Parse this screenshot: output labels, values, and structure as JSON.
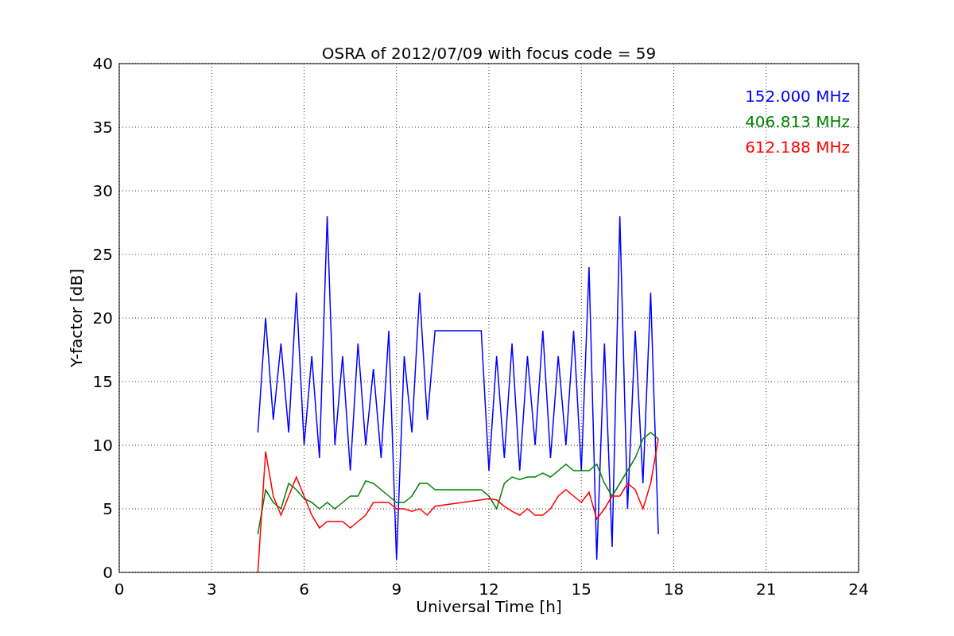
{
  "chart_data": {
    "type": "line",
    "grid": true,
    "title": "OSRA of 2012/07/09 with focus code = 59",
    "xlabel": "Universal Time [h]",
    "ylabel": "Y-factor [dB]",
    "xlim": [
      0,
      24
    ],
    "ylim": [
      0,
      40
    ],
    "xticks": [
      0,
      3,
      6,
      9,
      12,
      15,
      18,
      21,
      24
    ],
    "yticks": [
      0,
      5,
      10,
      15,
      20,
      25,
      30,
      35,
      40
    ],
    "x": [
      4.5,
      4.75,
      5.0,
      5.25,
      5.5,
      5.75,
      6.0,
      6.25,
      6.5,
      6.75,
      7.0,
      7.25,
      7.5,
      7.75,
      8.0,
      8.25,
      8.5,
      8.75,
      9.0,
      9.25,
      9.5,
      9.75,
      10.0,
      10.25,
      11.75,
      12.0,
      12.25,
      12.5,
      12.75,
      13.0,
      13.25,
      13.5,
      13.75,
      14.0,
      14.25,
      14.5,
      14.75,
      15.0,
      15.25,
      15.5,
      15.75,
      16.0,
      16.25,
      16.5,
      16.75,
      17.0,
      17.25,
      17.5
    ],
    "series": [
      {
        "name": "152.000 MHz",
        "color": "#0000ff",
        "values": [
          11,
          20,
          12,
          18,
          11,
          22,
          10,
          17,
          9,
          28,
          10,
          17,
          8,
          18,
          10,
          16,
          9,
          19,
          1,
          17,
          11,
          22,
          12,
          19,
          19,
          8,
          17,
          9,
          18,
          8,
          17,
          10,
          19,
          9,
          17,
          10,
          19,
          8,
          24,
          1,
          18,
          2,
          28,
          5,
          19,
          7,
          22,
          3
        ]
      },
      {
        "name": "406.813 MHz",
        "color": "#008000",
        "values": [
          3,
          6.5,
          5.5,
          5,
          7,
          6.5,
          5.8,
          5.5,
          5,
          5.5,
          5,
          5.5,
          6,
          6,
          7.2,
          7,
          6.5,
          6,
          5.5,
          5.5,
          6,
          7,
          7,
          6.5,
          6.5,
          6,
          5,
          7,
          7.5,
          7.3,
          7.5,
          7.5,
          7.8,
          7.5,
          8,
          8.5,
          8,
          8,
          8,
          8.5,
          7,
          6,
          7,
          8,
          9,
          10.5,
          11,
          10.5
        ]
      },
      {
        "name": "612.188 MHz",
        "color": "#ff0000",
        "values": [
          0,
          9.5,
          6,
          4.5,
          6,
          7.5,
          6,
          4.5,
          3.5,
          4,
          4,
          4,
          3.5,
          4,
          4.5,
          5.5,
          5.5,
          5.5,
          5,
          5,
          4.8,
          5,
          4.5,
          5.2,
          5.7,
          5.8,
          5.7,
          5.2,
          4.8,
          4.5,
          5,
          4.5,
          4.5,
          5,
          6,
          6.5,
          6,
          5.5,
          6.3,
          4.2,
          5,
          6,
          6,
          7,
          6.5,
          5,
          7,
          10.5
        ]
      }
    ]
  }
}
